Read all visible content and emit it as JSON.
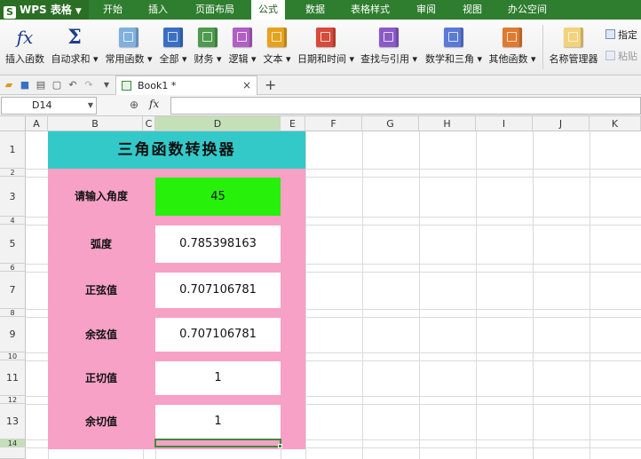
{
  "app": {
    "logo": "WPS 表格",
    "menu_tabs": [
      "开始",
      "插入",
      "页面布局",
      "公式",
      "数据",
      "表格样式",
      "审阅",
      "视图",
      "办公空间"
    ],
    "active_tab": "公式"
  },
  "ribbon": {
    "buttons": [
      {
        "label": "插入函数"
      },
      {
        "label": "自动求和 ▾"
      },
      {
        "label": "常用函数 ▾"
      },
      {
        "label": "全部 ▾"
      },
      {
        "label": "财务 ▾"
      },
      {
        "label": "逻辑 ▾"
      },
      {
        "label": "文本 ▾"
      },
      {
        "label": "日期和时间 ▾"
      },
      {
        "label": "查找与引用 ▾"
      },
      {
        "label": "数学和三角 ▾"
      },
      {
        "label": "其他函数 ▾"
      },
      {
        "label": "名称管理器"
      }
    ],
    "small_buttons": [
      "指定",
      "粘贴"
    ],
    "icon_colors": [
      "#7fb0e0",
      "#3a6fc4",
      "#4e9a4e",
      "#b05fc4",
      "#e6a21e",
      "#d84a3a",
      "#8a5ac8",
      "#5a7ad8",
      "#e07a30"
    ]
  },
  "document": {
    "tab_name": "Book1 *",
    "close_glyph": "×",
    "new_tab_glyph": "+"
  },
  "formula_bar": {
    "name_box": "D14",
    "fx_label": "fx",
    "formula": ""
  },
  "sheet": {
    "columns": [
      "A",
      "B",
      "C",
      "D",
      "E",
      "F",
      "G",
      "H",
      "I",
      "J",
      "K"
    ],
    "rows": [
      "1",
      "2",
      "3",
      "4",
      "5",
      "6",
      "7",
      "8",
      "9",
      "10",
      "11",
      "12",
      "13",
      "14"
    ],
    "selected_column": "D",
    "selected_row": "14",
    "title": "三角函数转换器",
    "fields": [
      {
        "label": "请输入角度",
        "value": "45"
      },
      {
        "label": "弧度",
        "value": "0.785398163"
      },
      {
        "label": "正弦值",
        "value": "0.707106781"
      },
      {
        "label": "余弦值",
        "value": "0.707106781"
      },
      {
        "label": "正切值",
        "value": "1"
      },
      {
        "label": "余切值",
        "value": "1"
      }
    ],
    "colors": {
      "title_bg": "#33c9c9",
      "panel_bg": "#f7a1c6",
      "input_bg": "#27f00a",
      "selection": "#3e8a3e"
    }
  }
}
